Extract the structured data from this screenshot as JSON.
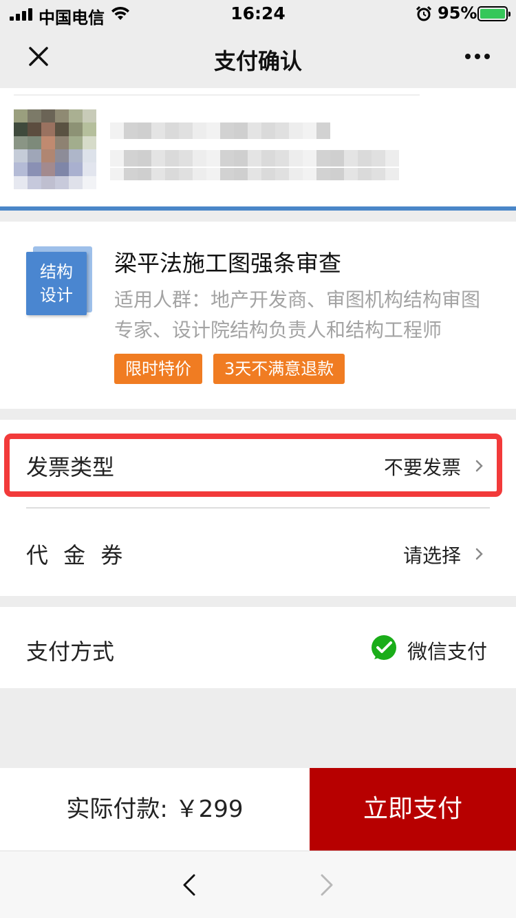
{
  "status_bar": {
    "carrier": "中国电信",
    "time": "16:24",
    "battery": "95%",
    "battery_color": "#35c759"
  },
  "nav": {
    "title": "支付确认",
    "close_icon": "close-icon",
    "more_icon": "more-icon"
  },
  "course": {
    "cover_line1": "结构",
    "cover_line2": "设计",
    "title": "梁平法施工图强条审查",
    "description": "适用人群：地产开发商、审图机构结构审图专家、设计院结构负责人和结构工程师",
    "tags": [
      "限时特价",
      "3天不满意退款"
    ],
    "tag_color": "#f07c22"
  },
  "options": {
    "invoice": {
      "label": "发票类型",
      "value": "不要发票"
    },
    "voucher": {
      "label": "代 金 券",
      "value": "请选择"
    },
    "payment": {
      "label": "支付方式",
      "value": "微信支付",
      "icon": "wechat-pay-icon"
    }
  },
  "pay_bar": {
    "amount_text": "实际付款: ￥299",
    "button_label": "立即支付",
    "button_color": "#b70000"
  },
  "colors": {
    "highlight_border": "#f23a3a",
    "divider_blue": "#4a86c8"
  }
}
